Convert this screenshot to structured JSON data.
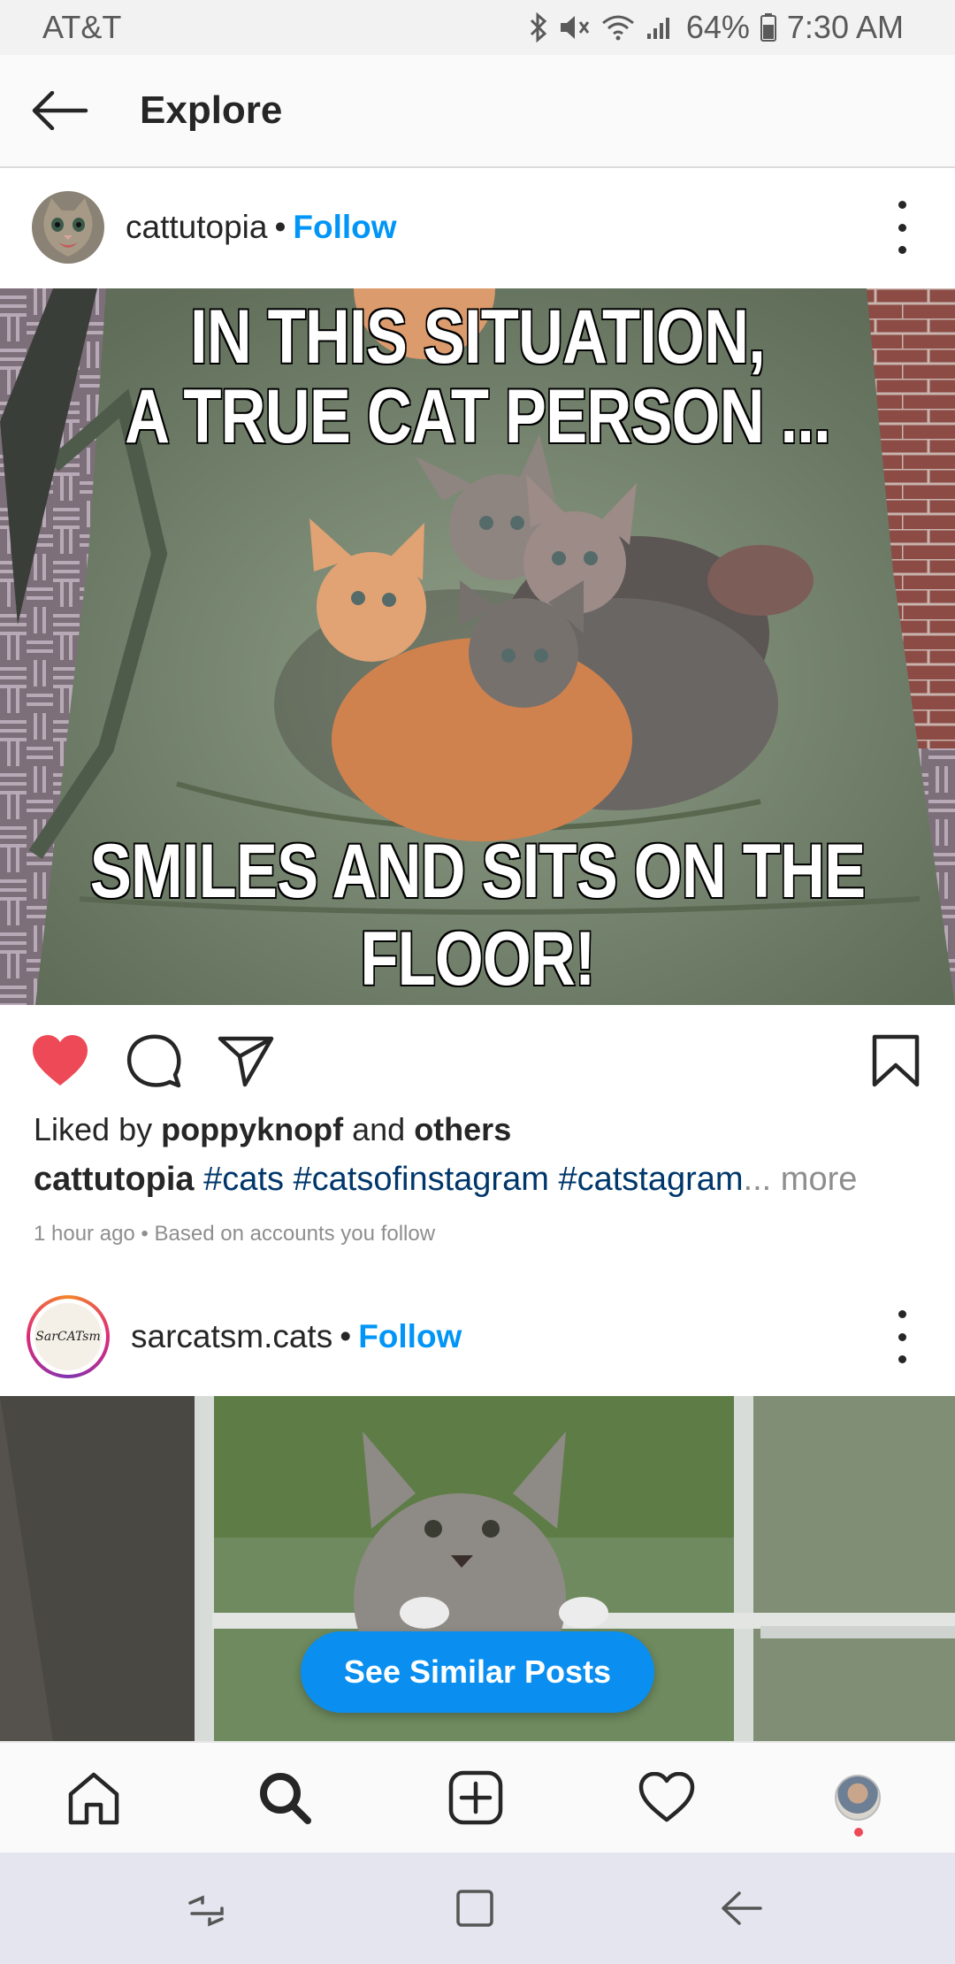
{
  "status_bar": {
    "carrier": "AT&T",
    "battery": "64%",
    "time": "7:30 AM"
  },
  "header": {
    "title": "Explore"
  },
  "post1": {
    "username": "cattutopia",
    "separator": "•",
    "follow": "Follow",
    "meme_top_line1": "IN THIS SITUATION,",
    "meme_top_line2": "A TRUE CAT PERSON ...",
    "meme_bottom": "SMILES AND SITS ON THE FLOOR!",
    "liked_prefix": "Liked by",
    "liked_user": "poppyknopf",
    "liked_and": "and",
    "liked_others": "others",
    "caption_user": "cattutopia",
    "hashtags": [
      "#cats",
      "#catsofinstagram",
      "#catstagram"
    ],
    "ellipsis": "...",
    "more": "more",
    "timestamp": "1 hour ago • Based on accounts you follow"
  },
  "post2": {
    "username": "sarcatsm.cats",
    "separator": "•",
    "follow": "Follow",
    "avatar_text": "SarCATsm"
  },
  "see_similar_label": "See Similar Posts",
  "colors": {
    "link_blue": "#0095f6",
    "hashtag_navy": "#00376b",
    "liked_red": "#ed4956",
    "button_blue": "#0a8ff0"
  },
  "icons": {
    "post_actions": [
      "heart-filled-icon",
      "comment-icon",
      "share-icon",
      "bookmark-icon"
    ],
    "bottom_nav": [
      "home-icon",
      "search-icon",
      "add-post-icon",
      "activity-heart-icon",
      "profile-avatar"
    ]
  }
}
